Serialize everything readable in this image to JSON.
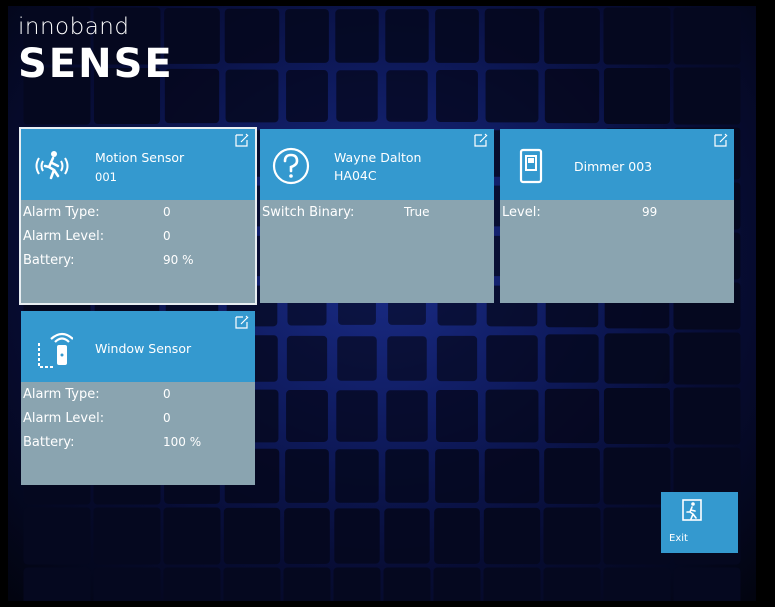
{
  "logo": {
    "line1": "innoband",
    "line2": "SENSE"
  },
  "cards": [
    {
      "title": "Motion Sensor",
      "subtitle": "001",
      "icon": "motion-sensor-icon",
      "rows": [
        {
          "label": "Alarm Type:",
          "value": "0"
        },
        {
          "label": "Alarm Level:",
          "value": "0"
        },
        {
          "label": "Battery:",
          "value": "90 %"
        }
      ]
    },
    {
      "title": "Wayne Dalton",
      "subtitle": "HA04C",
      "icon": "question-icon",
      "rows": [
        {
          "label": "Switch Binary:",
          "value": "True"
        }
      ]
    },
    {
      "title": "Dimmer 003",
      "subtitle": "",
      "icon": "dimmer-switch-icon",
      "rows": [
        {
          "label": "Level:",
          "value": "99"
        }
      ]
    },
    {
      "title": "Window Sensor",
      "subtitle": "",
      "icon": "window-sensor-icon",
      "rows": [
        {
          "label": "Alarm Type:",
          "value": "0"
        },
        {
          "label": "Alarm Level:",
          "value": "0"
        },
        {
          "label": "Battery:",
          "value": "100 %"
        }
      ]
    }
  ],
  "exit": {
    "label": "Exit",
    "icon": "exit-door-icon"
  },
  "colors": {
    "tile_header": "#3499cf",
    "tile_body": "#8aa4b0",
    "background": "#0e1a5c"
  }
}
